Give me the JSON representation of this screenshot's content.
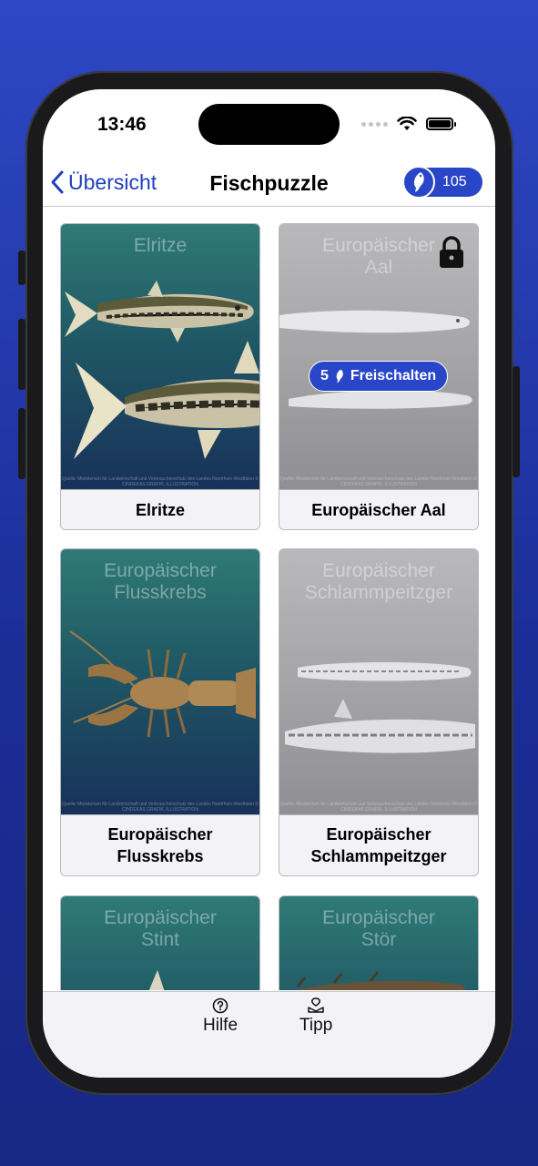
{
  "status_bar": {
    "time": "13:46"
  },
  "nav": {
    "back_label": "Übersicht",
    "title": "Fischpuzzle",
    "coins": "105"
  },
  "cards": [
    {
      "image_title": "Elritze",
      "caption": "Elritze",
      "locked": false,
      "credit": "Quelle: Ministerium für Landwirtschaft und Verbraucherschutz des Landes Nordrhein-Westfalen © CINDEKAS GRAFIK, ILLUSTRATION"
    },
    {
      "image_title_l1": "Europäischer",
      "image_title_l2": "Aal",
      "caption": "Europäischer Aal",
      "locked": true,
      "unlock_cost": "5",
      "unlock_label": "Freischalten",
      "credit": "Quelle: Ministerium für Landwirtschaft und Verbraucherschutz des Landes Nordrhein-Westfalen © CINDEKAS GRAFIK, ILLUSTRATION"
    },
    {
      "image_title_l1": "Europäischer",
      "image_title_l2": "Flusskrebs",
      "caption_l1": "Europäischer",
      "caption_l2": "Flusskrebs",
      "locked": false,
      "credit": "Quelle: Ministerium für Landwirtschaft und Verbraucherschutz des Landes Nordrhein-Westfalen © CINDEKAS GRAFIK, ILLUSTRATION"
    },
    {
      "image_title_l1": "Europäischer",
      "image_title_l2": "Schlammpeitzger",
      "caption_l1": "Europäischer",
      "caption_l2": "Schlammpeitzger",
      "locked": true,
      "credit": "Quelle: Ministerium für Landwirtschaft und Verbraucherschutz des Landes Nordrhein-Westfalen © CINDEKAS GRAFIK, ILLUSTRATION"
    },
    {
      "image_title_l1": "Europäischer",
      "image_title_l2": "Stint",
      "locked": false
    },
    {
      "image_title_l1": "Europäischer",
      "image_title_l2": "Stör",
      "locked": false
    }
  ],
  "tabbar": {
    "items": [
      {
        "label": "Hilfe",
        "icon": "question-circle-icon"
      },
      {
        "label": "Tipp",
        "icon": "tip-icon"
      }
    ]
  },
  "colors": {
    "accent": "#2a46c8",
    "background_gradient_top": "#2e48c4",
    "background_gradient_bottom": "#172783",
    "card_teal": "#1f5764",
    "card_locked_grey": "#a3a3a6"
  }
}
